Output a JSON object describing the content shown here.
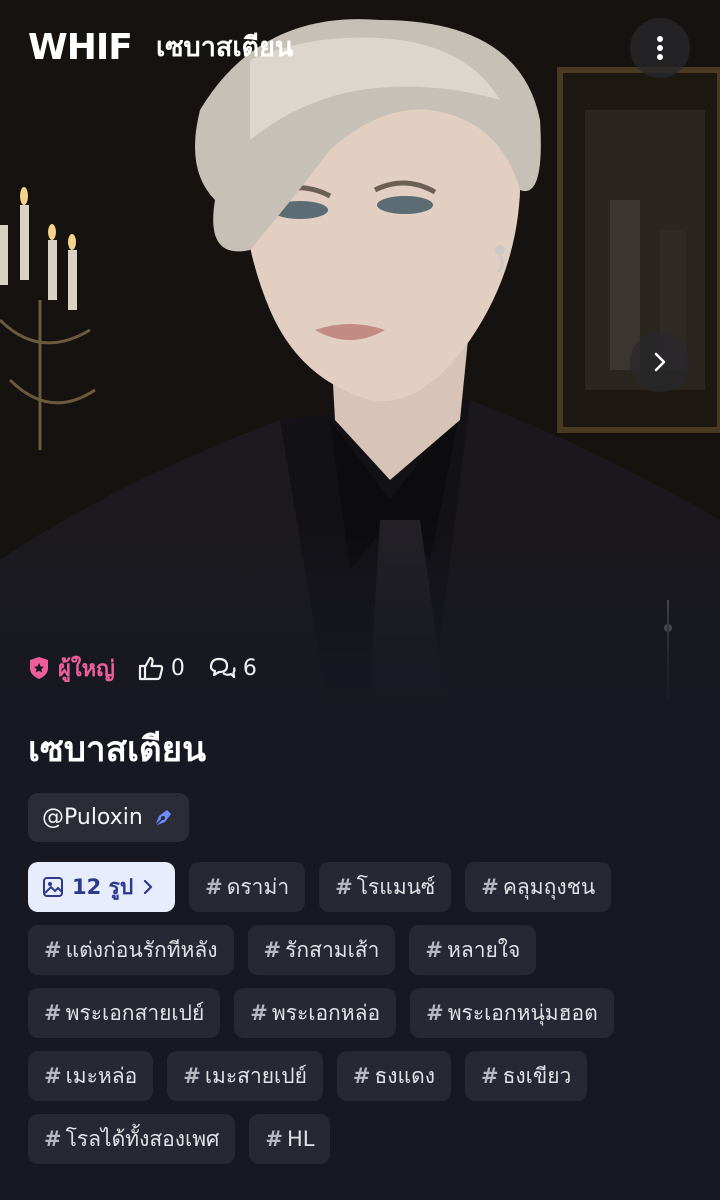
{
  "header": {
    "logo": "WHIF",
    "title": "เซบาสเตียน"
  },
  "character": {
    "age_rating": "ผู้ใหญ่",
    "likes": "0",
    "comments": "6",
    "name": "เซบาสเตียน",
    "author": "@Puloxin"
  },
  "gallery": {
    "label": "12 รูป"
  },
  "tags": [
    "ดราม่า",
    "โรแมนซ์",
    "คลุมถุงชน",
    "แต่งก่อนรักทีหลัง",
    "รักสามเส้า",
    "หลายใจ",
    "พระเอกสายเปย์",
    "พระเอกหล่อ",
    "พระเอกหนุ่มฮอต",
    "เมะหล่อ",
    "เมะสายเปย์",
    "ธงแดง",
    "ธงเขียว",
    "โรลได้ทั้งสองเพศ",
    "HL"
  ],
  "colors": {
    "background": "#171821",
    "age_badge": "#ec5f9b",
    "chip": "#272833",
    "gallery_chip_bg": "#e7edfc",
    "gallery_chip_text": "#2c3a8e",
    "author_icon": "#6c8cff"
  }
}
